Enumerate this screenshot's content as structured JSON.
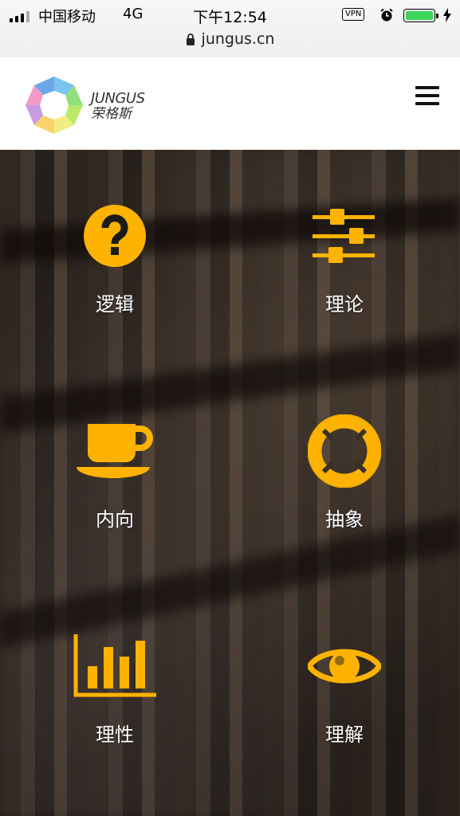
{
  "status_bar": {
    "carrier": "中国移动",
    "network": "4G",
    "time": "下午12:54",
    "vpn": "VPN"
  },
  "browser": {
    "url": "jungus.cn"
  },
  "site": {
    "logo_en": "JUNGUS",
    "logo_cn": "荣格斯"
  },
  "tiles": [
    {
      "label": "逻辑",
      "icon": "question-circle-icon"
    },
    {
      "label": "理论",
      "icon": "sliders-icon"
    },
    {
      "label": "内向",
      "icon": "coffee-cup-icon"
    },
    {
      "label": "抽象",
      "icon": "lifebuoy-icon"
    },
    {
      "label": "理性",
      "icon": "bar-chart-icon"
    },
    {
      "label": "理解",
      "icon": "eye-icon"
    }
  ],
  "colors": {
    "accent": "#FFB300",
    "battery": "#3CD65A"
  }
}
